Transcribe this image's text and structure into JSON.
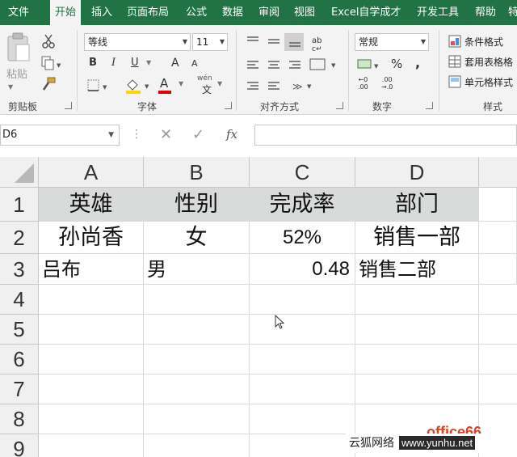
{
  "ribbon_tabs": [
    "文件",
    "开始",
    "插入",
    "页面布局",
    "公式",
    "数据",
    "审阅",
    "视图",
    "Excel自学成才",
    "开发工具",
    "帮助",
    "特"
  ],
  "active_tab": "开始",
  "clipboard": {
    "paste_label": "粘贴",
    "group_label": "剪贴板"
  },
  "font": {
    "name": "等线",
    "size": "11",
    "group_label": "字体",
    "bold": "B",
    "italic": "I",
    "underline": "U",
    "grow": "A",
    "shrink": "A",
    "font_color_glyph": "A",
    "phonetic": "wén"
  },
  "alignment": {
    "group_label": "对齐方式"
  },
  "number": {
    "format": "常规",
    "group_label": "数字",
    "percent": "%",
    "comma": ","
  },
  "styles": {
    "conditional": "条件格式",
    "table": "套用表格格",
    "cell": "单元格样式",
    "group_label": "样式"
  },
  "formula_bar": {
    "name_box": "D6",
    "fx_label": "fx",
    "value": ""
  },
  "columns": [
    "A",
    "B",
    "C",
    "D"
  ],
  "rows": [
    "1",
    "2",
    "3",
    "4",
    "5",
    "6",
    "7",
    "8",
    "9"
  ],
  "cells": {
    "r1": [
      "英雄",
      "性别",
      "完成率",
      "部门"
    ],
    "r2": [
      "孙尚香",
      "女",
      "52%",
      "销售一部"
    ],
    "r3": [
      "吕布",
      "男",
      "0.48",
      "销售二部"
    ]
  },
  "watermark": {
    "cn": "云狐网络",
    "url": "www.yunhu.net",
    "office": "office66"
  }
}
